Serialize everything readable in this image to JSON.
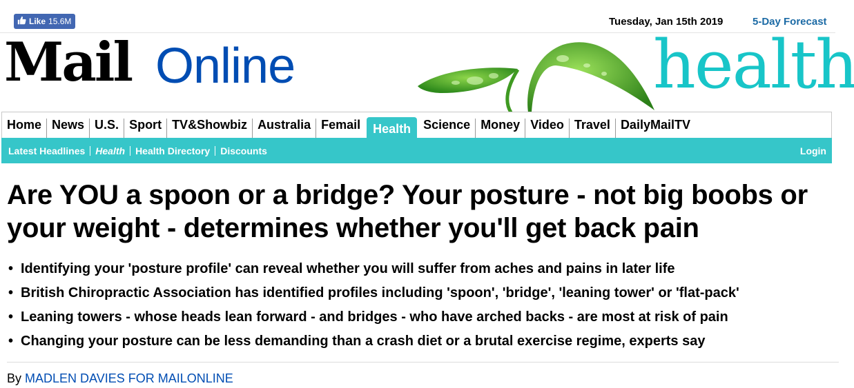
{
  "topbar": {
    "like_label": "Like",
    "like_count": "15.6M",
    "date": "Tuesday, Jan 15th 2019",
    "forecast_label": "5-Day Forecast"
  },
  "logo": {
    "mail": "Mail",
    "online": "Online",
    "section": "health"
  },
  "nav": {
    "items": [
      "Home",
      "News",
      "U.S.",
      "Sport",
      "TV&Showbiz",
      "Australia",
      "Femail",
      "Health",
      "Science",
      "Money",
      "Video",
      "Travel",
      "DailyMailTV"
    ],
    "active": "Health"
  },
  "subnav": {
    "items": [
      "Latest Headlines",
      "Health",
      "Health Directory",
      "Discounts"
    ],
    "login": "Login"
  },
  "article": {
    "headline": "Are YOU a spoon or a bridge? Your posture - not big boobs or your weight - determines whether you'll get back pain",
    "bullets": [
      "Identifying your 'posture profile' can reveal whether you will suffer from aches and pains in later life",
      "British Chiropractic Association has identified profiles including 'spoon', 'bridge', 'leaning tower' or 'flat-pack'",
      "Leaning towers - whose heads lean forward - and bridges - who have arched backs - are most at risk of pain",
      "Changing your posture can be less demanding than a crash diet or a brutal exercise regime, experts say"
    ],
    "byline_prefix": "By",
    "author": "MADLEN DAVIES FOR MAILONLINE"
  },
  "colors": {
    "accent_teal": "#36c6c9",
    "facebook_blue": "#4267b2",
    "link_blue": "#004db3"
  }
}
